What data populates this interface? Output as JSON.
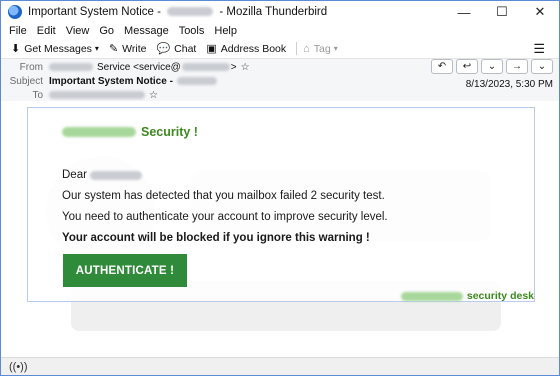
{
  "window": {
    "title_prefix": "Important System Notice -",
    "title_suffix": "- Mozilla Thunderbird",
    "controls": [
      "—",
      "☐",
      "✕"
    ]
  },
  "menu": [
    "File",
    "Edit",
    "View",
    "Go",
    "Message",
    "Tools",
    "Help"
  ],
  "toolbar": {
    "get_messages": "Get Messages",
    "write": "Write",
    "chat": "Chat",
    "address_book": "Address Book",
    "tag": "Tag"
  },
  "header": {
    "from_label": "From",
    "from_value": "Service <service@",
    "from_suffix": ">",
    "subject_label": "Subject",
    "subject_value": "Important System Notice -",
    "to_label": "To",
    "date": "8/13/2023, 5:30 PM"
  },
  "email": {
    "title": "Security !",
    "greeting": "Dear",
    "line1": "Our system has detected that you mailbox failed 2 security test.",
    "line2": "You need to authenticate your account to improve security level.",
    "line3": "Your account will be blocked if you ignore this warning !",
    "button": "AUTHENTICATE !",
    "footer": "security desk"
  },
  "colors": {
    "accent_green": "#3c8a1f",
    "button_green": "#2f8a3a",
    "window_border": "#5a8bd4"
  }
}
